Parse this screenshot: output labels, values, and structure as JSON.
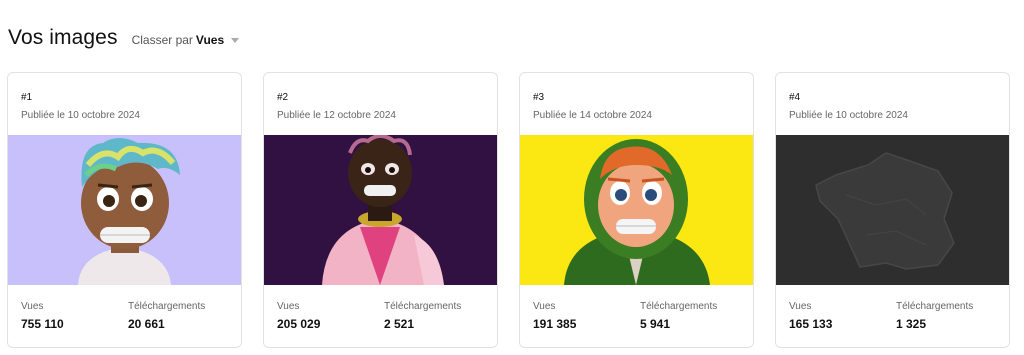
{
  "header": {
    "title": "Vos images",
    "sort_prefix": "Classer par",
    "sort_value": "Vues"
  },
  "labels": {
    "views": "Vues",
    "downloads": "Téléchargements"
  },
  "cards": [
    {
      "rank": "#1",
      "date": "Publiée le 10 octobre 2024",
      "views": "755 110",
      "downloads": "20 661",
      "bg": "#c8c0fb"
    },
    {
      "rank": "#2",
      "date": "Publiée le 12 octobre 2024",
      "views": "205 029",
      "downloads": "2 521",
      "bg": "#2a0f3a"
    },
    {
      "rank": "#3",
      "date": "Publiée le 14 octobre 2024",
      "views": "191 385",
      "downloads": "5 941",
      "bg": "#fbe813"
    },
    {
      "rank": "#4",
      "date": "Publiée le 10 octobre 2024",
      "views": "165 133",
      "downloads": "1 325",
      "bg": "#2e2e2e"
    }
  ]
}
